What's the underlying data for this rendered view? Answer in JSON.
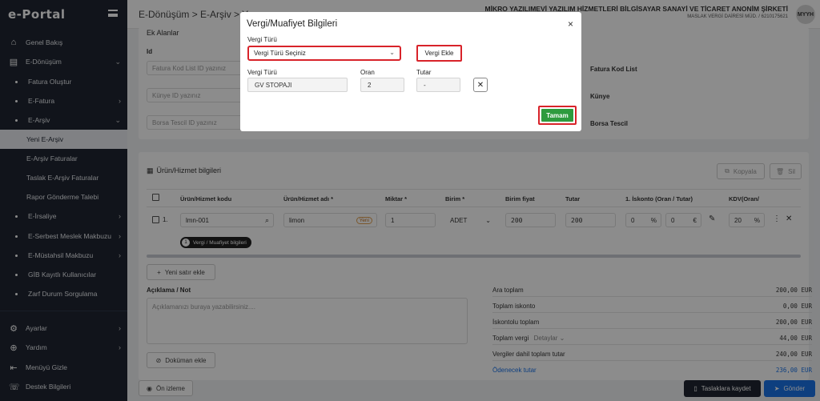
{
  "app": {
    "logo": "e-Portal"
  },
  "header": {
    "breadcrumb": "E-Dönüşüm > E-Arşiv > Y",
    "company_name": "MİKRO YAZILIMEVİ YAZILIM HİZMETLERİ BİLGİSAYAR SANAYİ VE TİCARET ANONİM ŞİRKETİ",
    "company_sub": "MASLAK VERGİ DAİRESİ MÜD. / 6210175621",
    "avatar": "MYYH"
  },
  "sidebar": {
    "items": [
      {
        "label": "Genel Bakış"
      },
      {
        "label": "E-Dönüşüm"
      },
      {
        "label": "Fatura Oluştur"
      },
      {
        "label": "E-Fatura"
      },
      {
        "label": "E-Arşiv"
      },
      {
        "label": "Yeni E-Arşiv"
      },
      {
        "label": "E-Arşiv Faturalar"
      },
      {
        "label": "Taslak E-Arşiv Faturalar"
      },
      {
        "label": "Rapor Gönderme Talebi"
      },
      {
        "label": "E-İrsaliye"
      },
      {
        "label": "E-Serbest Meslek Makbuzu"
      },
      {
        "label": "E-Müstahsil Makbuzu"
      },
      {
        "label": "GİB Kayıtlı Kullanıcılar"
      },
      {
        "label": "Zarf Durum Sorgulama"
      },
      {
        "label": "Ayarlar"
      },
      {
        "label": "Yardım"
      },
      {
        "label": "Menüyü Gizle"
      },
      {
        "label": "Destek Bilgileri"
      }
    ]
  },
  "ek_alanlar": {
    "title": "Ek Alanlar",
    "id_label": "Id",
    "fields": [
      {
        "placeholder": "Fatura Kod List ID yazınız",
        "label": "Fatura Kod List"
      },
      {
        "placeholder": "Künye ID yazınız",
        "label": "Künye"
      },
      {
        "placeholder": "Borsa Tescil ID yazınız",
        "label": "Borsa Tescil"
      }
    ]
  },
  "products": {
    "title": "Ürün/Hizmet bilgileri",
    "copy_label": "Kopyala",
    "delete_label": "Sil",
    "columns": [
      "Ürün/Hizmet kodu",
      "Ürün/Hizmet adı *",
      "Miktar *",
      "Birim *",
      "Birim fiyat",
      "Tutar",
      "1. İskonto (Oran / Tutar)",
      "KDV(Oran/"
    ],
    "row": {
      "index": "1.",
      "code": "lmn-001",
      "name": "limon",
      "name_badge": "Yeni",
      "quantity": "1",
      "unit": "ADET",
      "unit_price": "200",
      "amount": "200",
      "discount_rate": "0",
      "discount_amount": "0",
      "vat": "20",
      "tax_badge_count": "1",
      "tax_badge": "Vergi / Muafiyet bilgileri"
    },
    "add_row": "Yeni satır ekle"
  },
  "notes": {
    "label": "Açıklama / Not",
    "placeholder": "Açıklamanızı buraya yazabilirsiniz....",
    "doc_button": "Doküman ekle"
  },
  "summary": {
    "rows": [
      {
        "label": "Ara toplam",
        "value": "200,00 EUR"
      },
      {
        "label": "Toplam iskonto",
        "value": "0,00 EUR"
      },
      {
        "label": "İskontolu toplam",
        "value": "200,00 EUR"
      },
      {
        "label": "Toplam vergi",
        "detail": "Detaylar",
        "value": "44,00 EUR"
      },
      {
        "label": "Vergiler dahil toplam tutar",
        "value": "240,00 EUR"
      },
      {
        "label": "Ödenecek tutar",
        "value": "236,00 EUR"
      }
    ]
  },
  "footer": {
    "preview": "Ön izleme",
    "draft": "Taslaklara kaydet",
    "send": "Gönder"
  },
  "modal": {
    "title": "Vergi/Muafiyet Bilgileri",
    "close": "×",
    "vergi_turu_label": "Vergi Türü",
    "select_value": "Vergi Türü Seçiniz",
    "add_button": "Vergi Ekle",
    "col_type": "Vergi Türü",
    "col_rate": "Oran",
    "col_amount": "Tutar",
    "row_type": "GV STOPAJI",
    "row_rate": "2",
    "row_amount": "-",
    "ok_button": "Tamam"
  },
  "colors": {
    "sidebar_bg": "#1f2632",
    "highlight_red": "#d8232a",
    "ok_green": "#2e9b3e",
    "primary_blue": "#1a73e8",
    "dark_button": "#1f2632"
  }
}
